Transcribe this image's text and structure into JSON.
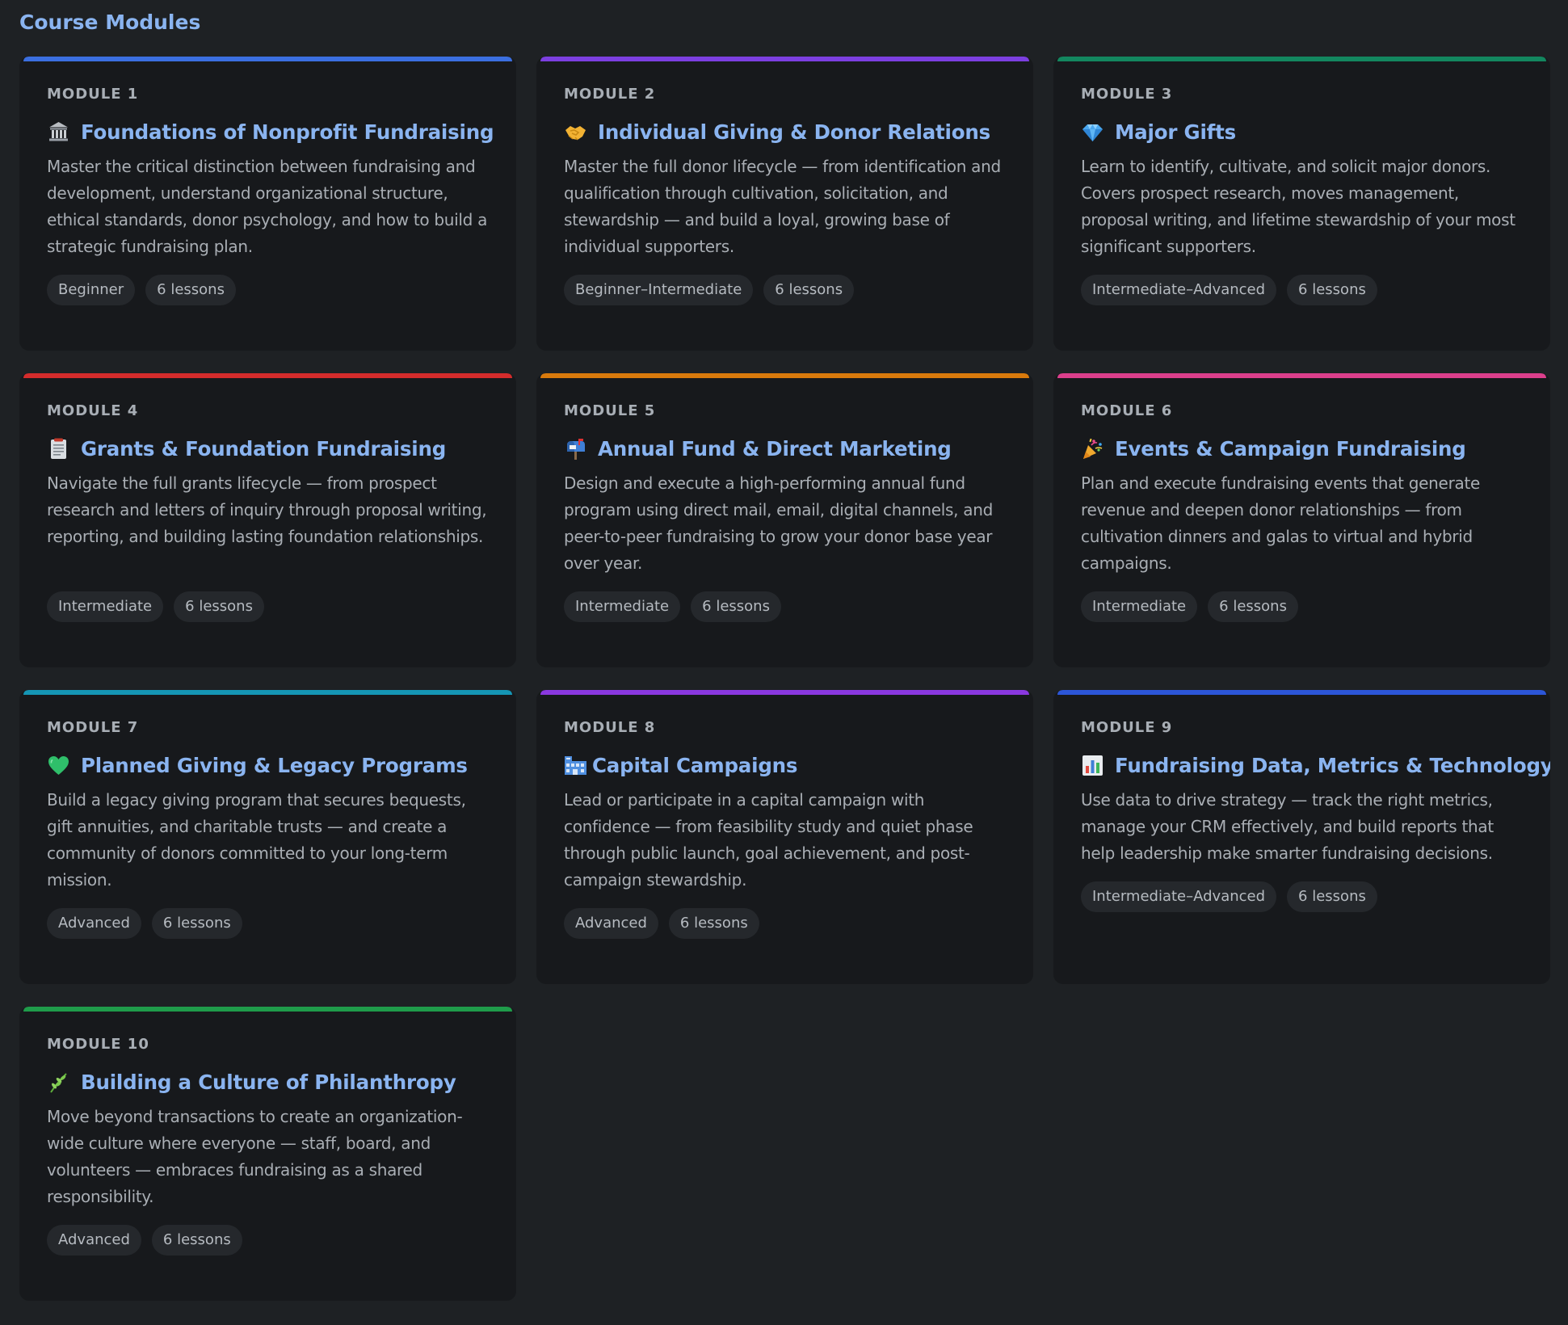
{
  "page_title": "Course Modules",
  "modules": [
    {
      "number": "MODULE 1",
      "icon": "classical-building-icon",
      "title": "Foundations of Nonprofit Fundraising",
      "description": "Master the critical distinction between fundraising and development, understand organizational structure, ethical standards, donor psychology, and how to build a strategic fundraising plan.",
      "level": "Beginner",
      "lessons": "6 lessons",
      "accent": "#3b6fe0"
    },
    {
      "number": "MODULE 2",
      "icon": "handshake-icon",
      "title": "Individual Giving & Donor Relations",
      "description": "Master the full donor lifecycle — from identification and qualification through cultivation, solicitation, and stewardship — and build a loyal, growing base of individual supporters.",
      "level": "Beginner–Intermediate",
      "lessons": "6 lessons",
      "accent": "#7c3fe0"
    },
    {
      "number": "MODULE 3",
      "icon": "gem-icon",
      "title": "Major Gifts",
      "description": "Learn to identify, cultivate, and solicit major donors. Covers prospect research, moves management, proposal writing, and lifetime stewardship of your most significant supporters.",
      "level": "Intermediate–Advanced",
      "lessons": "6 lessons",
      "accent": "#13875f"
    },
    {
      "number": "MODULE 4",
      "icon": "clipboard-icon",
      "title": "Grants & Foundation Fundraising",
      "description": "Navigate the full grants lifecycle — from prospect research and letters of inquiry through proposal writing, reporting, and building lasting foundation relationships.",
      "level": "Intermediate",
      "lessons": "6 lessons",
      "accent": "#d42c2c"
    },
    {
      "number": "MODULE 5",
      "icon": "mailbox-icon",
      "title": "Annual Fund & Direct Marketing",
      "description": "Design and execute a high-performing annual fund program using direct mail, email, digital channels, and peer-to-peer fundraising to grow your donor base year over year.",
      "level": "Intermediate",
      "lessons": "6 lessons",
      "accent": "#d97a0c"
    },
    {
      "number": "MODULE 6",
      "icon": "party-popper-icon",
      "title": "Events & Campaign Fundraising",
      "description": "Plan and execute fundraising events that generate revenue and deepen donor relationships — from cultivation dinners and galas to virtual and hybrid campaigns.",
      "level": "Intermediate",
      "lessons": "6 lessons",
      "accent": "#dc3f8c"
    },
    {
      "number": "MODULE 7",
      "icon": "green-heart-icon",
      "title": "Planned Giving & Legacy Programs",
      "description": "Build a legacy giving program that secures bequests, gift annuities, and charitable trusts — and create a community of donors committed to your long-term mission.",
      "level": "Advanced",
      "lessons": "6 lessons",
      "accent": "#1596b5"
    },
    {
      "number": "MODULE 8",
      "icon": "construction-building-icon",
      "title": "Capital Campaigns",
      "description": "Lead or participate in a capital campaign with confidence — from feasibility study and quiet phase through public launch, goal achievement, and post-campaign stewardship.",
      "level": "Advanced",
      "lessons": "6 lessons",
      "accent": "#8a38e0"
    },
    {
      "number": "MODULE 9",
      "icon": "bar-chart-icon",
      "title": "Fundraising Data, Metrics & Technology",
      "description": "Use data to drive strategy — track the right metrics, manage your CRM effectively, and build reports that help leadership make smarter fundraising decisions.",
      "level": "Intermediate–Advanced",
      "lessons": "6 lessons",
      "accent": "#2c56d8"
    },
    {
      "number": "MODULE 10",
      "icon": "herb-icon",
      "title": "Building a Culture of Philanthropy",
      "description": "Move beyond transactions to create an organization-wide culture where everyone — staff, board, and volunteers — embraces fundraising as a shared responsibility.",
      "level": "Advanced",
      "lessons": "6 lessons",
      "accent": "#1f9c4a"
    }
  ]
}
